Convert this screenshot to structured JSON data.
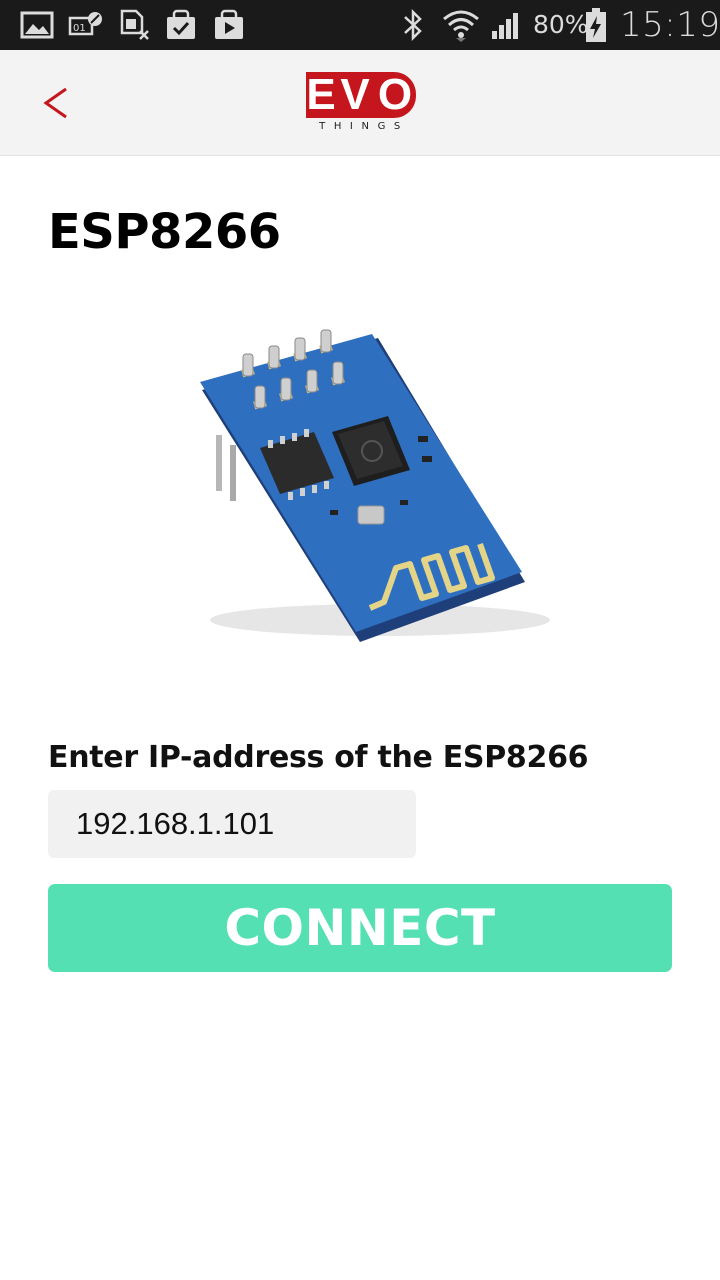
{
  "status_bar": {
    "battery_percent": "80%",
    "time": "15:19",
    "icons": [
      "gallery-icon",
      "voicemail-icon",
      "sim-icon",
      "store-check-icon",
      "play-store-icon",
      "bluetooth-icon",
      "wifi-icon",
      "signal-icon",
      "battery-charging-icon"
    ]
  },
  "header": {
    "back_icon": "chevron-left-icon",
    "logo": {
      "top": "EVO",
      "bottom": "THINGS",
      "color": "#c4161c"
    }
  },
  "main": {
    "title": "ESP8266",
    "image_icon": "esp8266-module-image",
    "ip_label": "Enter IP-address of the ESP8266",
    "ip_value": "192.168.1.101",
    "connect_label": "CONNECT"
  },
  "colors": {
    "accent": "#54e0b3",
    "brand": "#c4161c",
    "status_bar_bg": "#1a1a1a",
    "header_bg": "#f3f3f3"
  }
}
